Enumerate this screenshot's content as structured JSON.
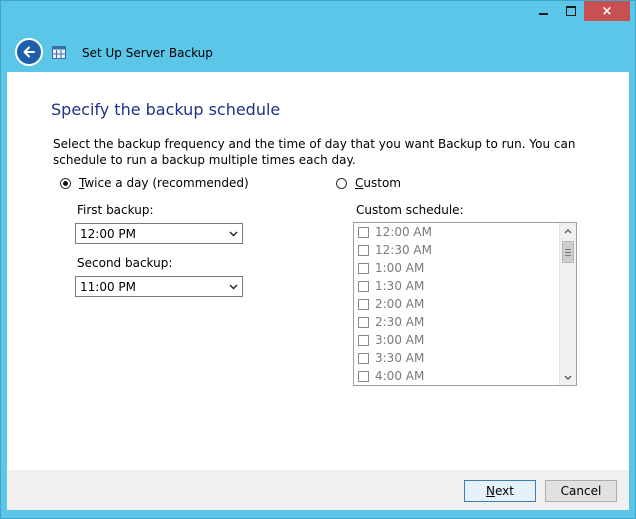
{
  "window": {
    "title": "Set Up Server Backup",
    "caption": {
      "minimize": "minimize",
      "maximize": "maximize",
      "close": "×"
    }
  },
  "page": {
    "heading": "Specify the backup schedule",
    "description": "Select the backup frequency and the time of day that you want Backup to run. You can schedule to run a backup multiple times each day."
  },
  "options": {
    "twice": {
      "accel": "T",
      "rest": "wice a day (recommended)",
      "selected": true
    },
    "custom": {
      "accel": "C",
      "rest": "ustom",
      "selected": false
    }
  },
  "first_backup": {
    "label": "First backup:",
    "value": "12:00 PM"
  },
  "second_backup": {
    "label": "Second backup:",
    "value": "11:00 PM"
  },
  "custom_schedule": {
    "label": "Custom schedule:",
    "items": [
      "12:00 AM",
      "12:30 AM",
      "1:00 AM",
      "1:30 AM",
      "2:00 AM",
      "2:30 AM",
      "3:00 AM",
      "3:30 AM",
      "4:00 AM"
    ]
  },
  "footer": {
    "next": {
      "accel": "N",
      "rest": "ext"
    },
    "cancel": "Cancel"
  },
  "colors": {
    "frame": "#5bc6e8",
    "heading": "#1e3287",
    "back_button": "#1f5fab",
    "close_button": "#c75050"
  },
  "icons": [
    "back-arrow-icon",
    "server-backup-icon",
    "chevron-down-icon",
    "scroll-up-icon",
    "scroll-down-icon"
  ]
}
